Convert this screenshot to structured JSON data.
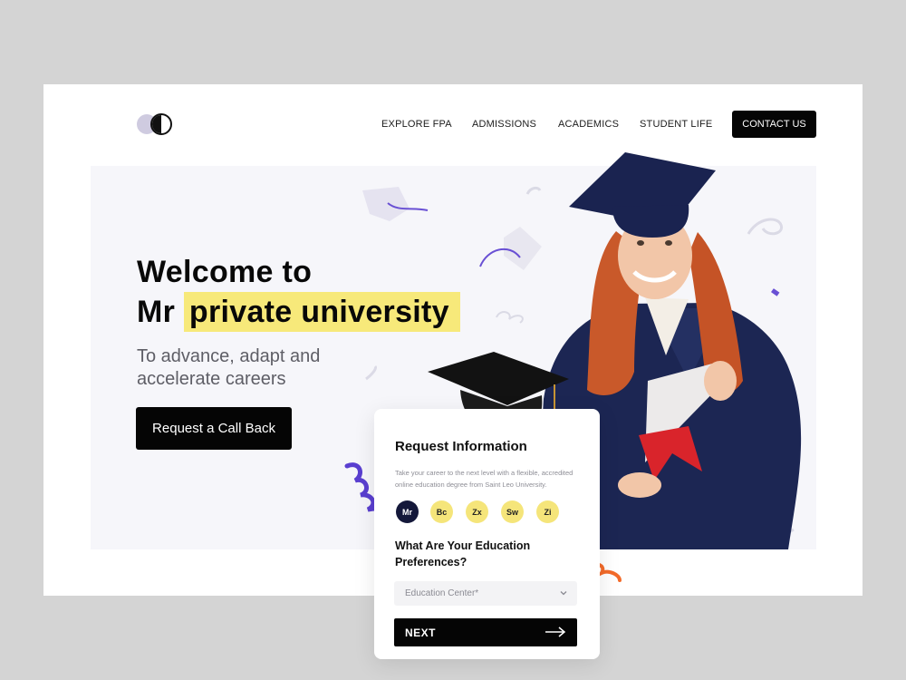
{
  "nav": {
    "items": [
      {
        "label": "EXPLORE FPA"
      },
      {
        "label": "ADMISSIONS"
      },
      {
        "label": "ACADEMICS"
      },
      {
        "label": "STUDENT LIFE"
      }
    ],
    "contact_label": "CONTACT US",
    "logo_icon": "twin-circle-logo-icon"
  },
  "hero": {
    "title_line1": "Welcome to",
    "title_prefix": "Mr",
    "title_highlight": "private university",
    "subtitle": "To advance, adapt and accelerate careers",
    "cta_label": "Request a Call Back",
    "highlight_color": "#f7e97a"
  },
  "card": {
    "title": "Request Information",
    "description": "Take your career to the next level with a flexible, accredited online education degree from Saint Leo University.",
    "chips": [
      {
        "label": "Mr",
        "active": true
      },
      {
        "label": "Bc",
        "active": false
      },
      {
        "label": "Zx",
        "active": false
      },
      {
        "label": "Sw",
        "active": false
      },
      {
        "label": "Zi",
        "active": false
      }
    ],
    "question": "What Are Your Education Preferences?",
    "select_placeholder": "Education Center*",
    "next_label": "NEXT"
  },
  "colors": {
    "accent_dark": "#14183a",
    "chip_yellow": "#f5e57a",
    "confetti_purple": "#5a3fd0",
    "confetti_orange": "#f36b2a"
  }
}
